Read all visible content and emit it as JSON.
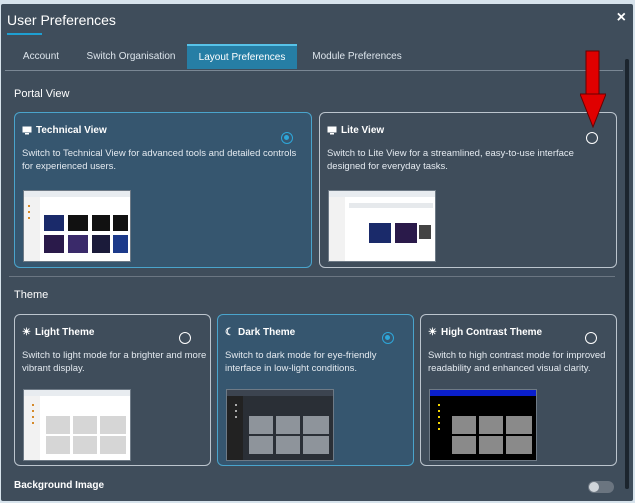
{
  "dialog": {
    "title": "User Preferences",
    "close_label": "×"
  },
  "tabs": [
    {
      "label": "Account",
      "active": false
    },
    {
      "label": "Switch Organisation",
      "active": false
    },
    {
      "label": "Layout Preferences",
      "active": true
    },
    {
      "label": "Module Preferences",
      "active": false
    }
  ],
  "portal_view": {
    "heading": "Portal View",
    "options": [
      {
        "title": "Technical View",
        "icon": "monitor-icon",
        "selected": true,
        "description": "Switch to Technical View for advanced tools and detailed controls for experienced users."
      },
      {
        "title": "Lite View",
        "icon": "monitor-icon",
        "selected": false,
        "description": "Switch to Lite View for a streamlined, easy-to-use interface designed for everyday tasks."
      }
    ]
  },
  "theme": {
    "heading": "Theme",
    "options": [
      {
        "title": "Light Theme",
        "icon": "sun-icon",
        "glyph": "☀",
        "selected": false,
        "description": "Switch to light mode for a brighter and more vibrant display."
      },
      {
        "title": "Dark Theme",
        "icon": "moon-icon",
        "glyph": "☾",
        "selected": true,
        "description": "Switch to dark mode for eye-friendly interface in low-light conditions."
      },
      {
        "title": "High Contrast Theme",
        "icon": "sun-icon",
        "glyph": "☀",
        "selected": false,
        "description": "Switch to high contrast mode for improved readability and enhanced visual clarity."
      }
    ]
  },
  "background_image": {
    "label": "Background Image",
    "enabled": false
  },
  "colors": {
    "accent": "#2ea6d9",
    "tab_active": "#267ea5",
    "arrow": "#e00000"
  }
}
